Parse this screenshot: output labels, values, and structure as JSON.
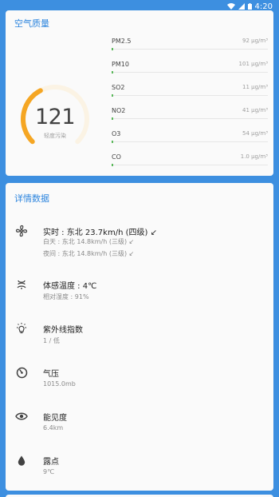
{
  "status_bar": {
    "time": "4:20"
  },
  "air_quality": {
    "title": "空气质量",
    "aqi": "121",
    "level": "轻度污染",
    "gauge_fraction": 0.4,
    "gauge_color": "#f5a623",
    "pollutants": [
      {
        "name": "PM2.5",
        "value": "92 μg/m³",
        "fraction": 0.01
      },
      {
        "name": "PM10",
        "value": "101 μg/m³",
        "fraction": 0.01
      },
      {
        "name": "SO2",
        "value": "11 μg/m³",
        "fraction": 0.01
      },
      {
        "name": "NO2",
        "value": "41 μg/m³",
        "fraction": 0.01
      },
      {
        "name": "O3",
        "value": "54 μg/m³",
        "fraction": 0.01
      },
      {
        "name": "CO",
        "value": "1.0 μg/m³",
        "fraction": 0.01
      }
    ]
  },
  "details": {
    "title": "详情数据",
    "wind": {
      "main": "实时 : 东北 23.7km/h (四级) ↙",
      "day": "白天 : 东北 14.8km/h (三级) ↙",
      "night": "夜间 : 东北 14.8km/h (三级) ↙"
    },
    "feels_like": {
      "main": "体感温度 : 4℃",
      "sub": "相对湿度 : 91%"
    },
    "uv": {
      "main": "紫外线指数",
      "sub": "1 / 低"
    },
    "pressure": {
      "main": "气压",
      "sub": "1015.0mb"
    },
    "visibility": {
      "main": "能见度",
      "sub": "6.4km"
    },
    "dew_point": {
      "main": "露点",
      "sub": "9℃"
    }
  }
}
